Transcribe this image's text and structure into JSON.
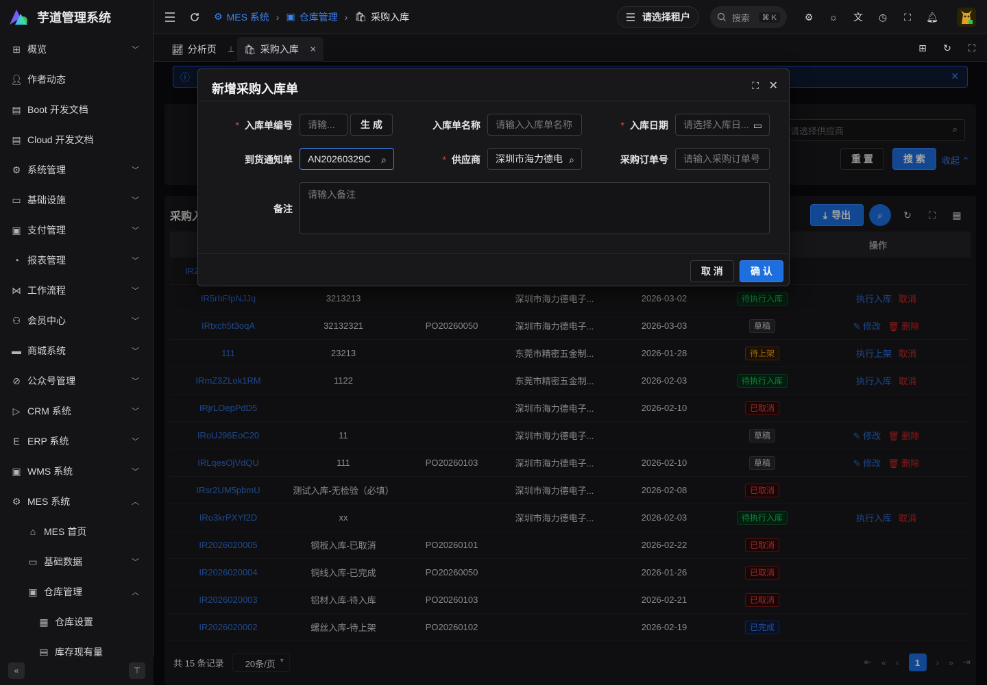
{
  "app": {
    "title": "芋道管理系统"
  },
  "sidebar": {
    "items": [
      {
        "label": "概览",
        "icon": "dashboard-icon",
        "expand": "down"
      },
      {
        "label": "作者动态",
        "icon": "user-icon",
        "expand": ""
      },
      {
        "label": "Boot 开发文档",
        "icon": "doc-icon",
        "expand": ""
      },
      {
        "label": "Cloud 开发文档",
        "icon": "doc-icon",
        "expand": ""
      },
      {
        "label": "系统管理",
        "icon": "gear-icon",
        "expand": "down"
      },
      {
        "label": "基础设施",
        "icon": "monitor-icon",
        "expand": "down"
      },
      {
        "label": "支付管理",
        "icon": "payment-icon",
        "expand": "down"
      },
      {
        "label": "报表管理",
        "icon": "pie-icon",
        "expand": "down"
      },
      {
        "label": "工作流程",
        "icon": "flow-icon",
        "expand": "down"
      },
      {
        "label": "会员中心",
        "icon": "members-icon",
        "expand": "down"
      },
      {
        "label": "商城系统",
        "icon": "shop-icon",
        "expand": "down"
      },
      {
        "label": "公众号管理",
        "icon": "compass-icon",
        "expand": "down"
      },
      {
        "label": "CRM 系统",
        "icon": "crm-icon",
        "expand": "down"
      },
      {
        "label": "ERP 系统",
        "icon": "erp-icon",
        "expand": "down"
      },
      {
        "label": "WMS 系统",
        "icon": "wms-icon",
        "expand": "down"
      },
      {
        "label": "MES 系统",
        "icon": "chip-icon",
        "expand": "up"
      }
    ],
    "mes_children": [
      {
        "label": "MES 首页",
        "icon": "home-icon",
        "expand": ""
      },
      {
        "label": "基础数据",
        "icon": "data-icon",
        "expand": "down"
      },
      {
        "label": "仓库管理",
        "icon": "warehouse-icon",
        "expand": "up"
      }
    ],
    "warehouse_children": [
      {
        "label": "仓库设置",
        "icon": "building-icon"
      },
      {
        "label": "库存现有量",
        "icon": "doc-icon"
      }
    ]
  },
  "header": {
    "breadcrumb": [
      "MES 系统",
      "仓库管理",
      "采购入库"
    ],
    "tenant": "请选择租户",
    "search_placeholder": "搜索",
    "search_kbd": "⌘ K"
  },
  "tabs": [
    {
      "label": "分析页"
    },
    {
      "label": "采购入库"
    }
  ],
  "page": {
    "supplier_placeholder": "请选择供应商",
    "reset": "重 置",
    "search": "搜 索",
    "collapse": "收起",
    "list_title": "采购入",
    "export": "导出",
    "op_header": "操作",
    "partial_code": "IR2"
  },
  "table_rows": [
    {
      "code": "IR5rhFfpNJJq",
      "name": "3213213",
      "po": "",
      "supplier": "深圳市海力德电子...",
      "date": "2026-03-02",
      "status": "待执行入库",
      "color": "green",
      "actions": [
        "执行入库",
        "取消"
      ]
    },
    {
      "code": "IRtxch5t3oqA",
      "name": "32132321",
      "po": "PO20260050",
      "supplier": "深圳市海力德电子...",
      "date": "2026-03-03",
      "status": "草稿",
      "color": "grey",
      "actions": [
        "修改",
        "删除"
      ]
    },
    {
      "code": "111",
      "name": "23213",
      "po": "",
      "supplier": "东莞市精密五金制...",
      "date": "2026-01-28",
      "status": "待上架",
      "color": "orange",
      "actions": [
        "执行上架",
        "取消"
      ]
    },
    {
      "code": "IRmZ3ZLok1RM",
      "name": "1122",
      "po": "",
      "supplier": "东莞市精密五金制...",
      "date": "2026-02-03",
      "status": "待执行入库",
      "color": "green",
      "actions": [
        "执行入库",
        "取消"
      ]
    },
    {
      "code": "IRjrLOepPdD5",
      "name": "",
      "po": "",
      "supplier": "深圳市海力德电子...",
      "date": "2026-02-10",
      "status": "已取消",
      "color": "red",
      "actions": []
    },
    {
      "code": "IRoUJ96EoC20",
      "name": "11",
      "po": "",
      "supplier": "深圳市海力德电子...",
      "date": "",
      "status": "草稿",
      "color": "grey",
      "actions": [
        "修改",
        "删除"
      ]
    },
    {
      "code": "IRLqesOjVdQU",
      "name": "111",
      "po": "PO20260103",
      "supplier": "深圳市海力德电子...",
      "date": "2026-02-10",
      "status": "草稿",
      "color": "grey",
      "actions": [
        "修改",
        "删除"
      ]
    },
    {
      "code": "IRsr2UM5pbmU",
      "name": "测试入库-无检验（必填）",
      "po": "",
      "supplier": "深圳市海力德电子...",
      "date": "2026-02-08",
      "status": "已取消",
      "color": "red",
      "actions": []
    },
    {
      "code": "IRo3krPXYf2D",
      "name": "xx",
      "po": "",
      "supplier": "深圳市海力德电子...",
      "date": "2026-02-03",
      "status": "待执行入库",
      "color": "green",
      "actions": [
        "执行入库",
        "取消"
      ]
    },
    {
      "code": "IR2026020005",
      "name": "钢板入库-已取消",
      "po": "PO20260101",
      "supplier": "",
      "date": "2026-02-22",
      "status": "已取消",
      "color": "red",
      "actions": []
    },
    {
      "code": "IR2026020004",
      "name": "铜线入库-已完成",
      "po": "PO20260050",
      "supplier": "",
      "date": "2026-01-26",
      "status": "已取消",
      "color": "red",
      "actions": []
    },
    {
      "code": "IR2026020003",
      "name": "铝材入库-待入库",
      "po": "PO20260103",
      "supplier": "",
      "date": "2026-02-21",
      "status": "已取消",
      "color": "red",
      "actions": []
    },
    {
      "code": "IR2026020002",
      "name": "螺丝入库-待上架",
      "po": "PO20260102",
      "supplier": "",
      "date": "2026-02-19",
      "status": "已完成",
      "color": "blue",
      "actions": []
    }
  ],
  "footer": {
    "total": "共 15 条记录",
    "page_size": "20条/页",
    "current_page": "1"
  },
  "modal": {
    "title": "新增采购入库单",
    "fields": {
      "code_label": "入库单编号",
      "code_placeholder": "请输...",
      "generate": "生 成",
      "name_label": "入库单名称",
      "name_placeholder": "请输入入库单名称",
      "date_label": "入库日期",
      "date_placeholder": "请选择入库日...",
      "notice_label": "到货通知单",
      "notice_value": "AN20260329C",
      "supplier_label": "供应商",
      "supplier_value": "深圳市海力德电",
      "po_label": "采购订单号",
      "po_placeholder": "请输入采购订单号",
      "remark_label": "备注",
      "remark_placeholder": "请输入备注"
    },
    "cancel": "取 消",
    "confirm": "确 认"
  },
  "colors": {
    "primary": "#1d6fe0",
    "required": "#ef4444",
    "danger": "#dc2626"
  }
}
